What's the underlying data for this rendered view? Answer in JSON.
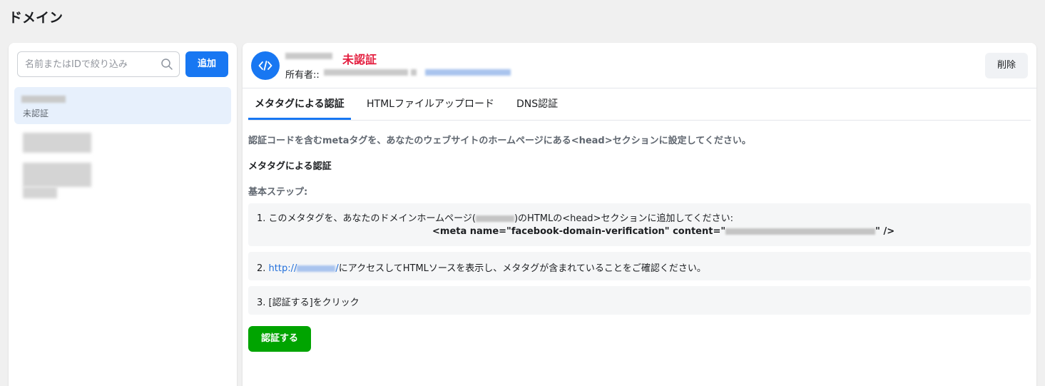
{
  "page": {
    "title": "ドメイン"
  },
  "sidebar": {
    "search_placeholder": "名前またはIDで絞り込み",
    "add_label": "追加",
    "selected_item": {
      "status": "未認証"
    }
  },
  "header": {
    "status": "未認証",
    "owner_label": "所有者::",
    "delete_label": "削除"
  },
  "tabs": [
    {
      "label": "メタタグによる認証",
      "active": true
    },
    {
      "label": "HTMLファイルアップロード",
      "active": false
    },
    {
      "label": "DNS認証",
      "active": false
    }
  ],
  "content": {
    "intro": "認証コードを含むmetaタグを、あなたのウェブサイトのホームページにある<head>セクションに設定してください。",
    "section_heading": "メタタグによる認証",
    "steps_heading": "基本ステップ:",
    "step1": {
      "prefix": "1. このメタタグを、あなたのドメインホームページ(",
      "suffix": ")のHTMLの<head>セクションに追加してください:",
      "meta_prefix": "<meta name=\"facebook-domain-verification\" content=\"",
      "meta_suffix": "\" />"
    },
    "step2": {
      "prefix": "2. ",
      "link_prefix": "http://",
      "link_suffix": "/",
      "suffix": "にアクセスしてHTMLソースを表示し、メタタグが含まれていることをご確認ください。"
    },
    "step3": {
      "text": "3. [認証する]をクリック"
    },
    "verify_label": "認証する"
  },
  "colors": {
    "primary": "#1877f2",
    "success": "#00a400",
    "danger": "#e41e3f",
    "link": "#216fdb"
  }
}
